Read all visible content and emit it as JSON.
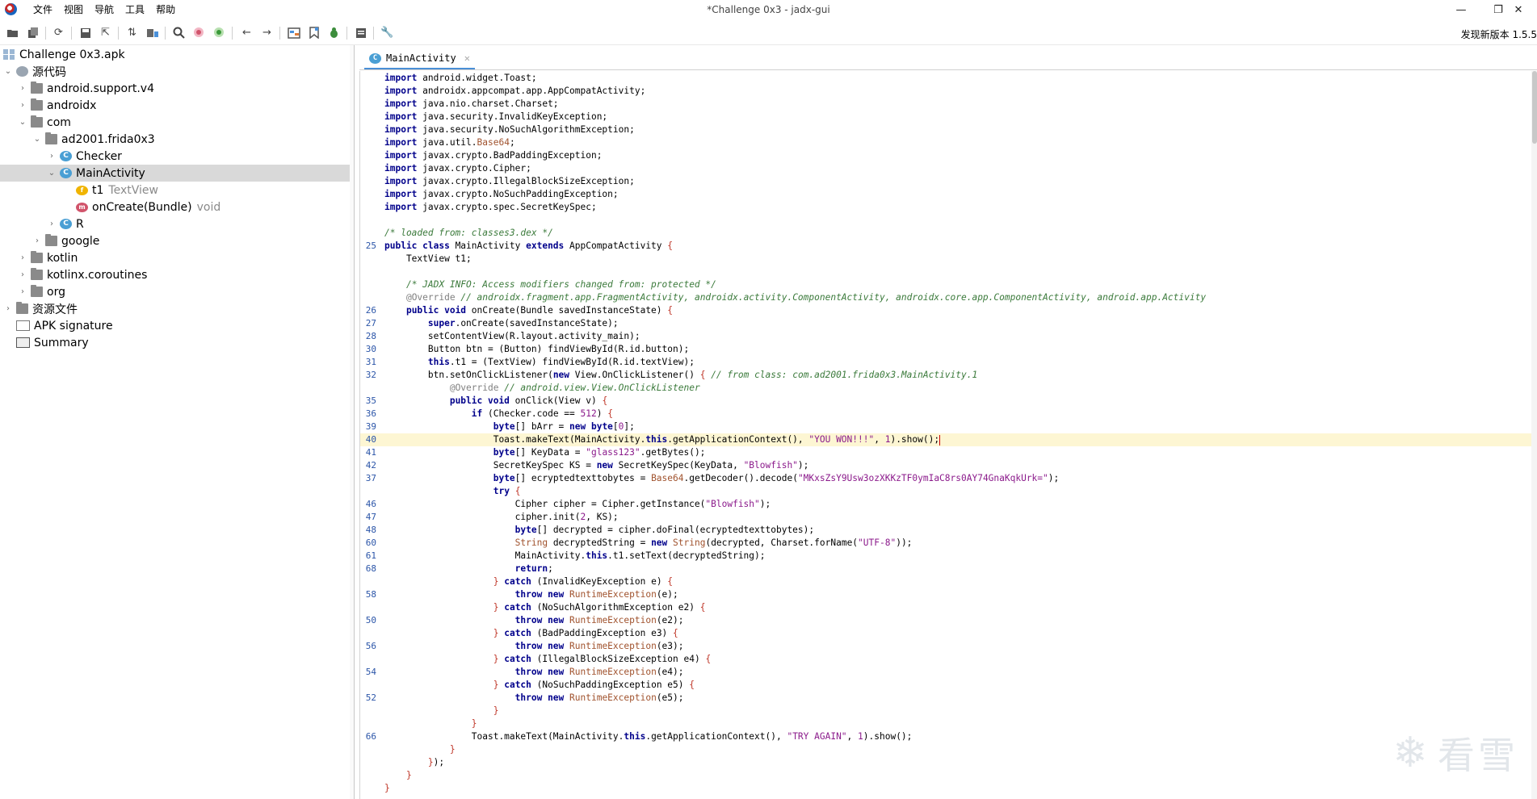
{
  "window": {
    "title": "*Challenge 0x3 - jadx-gui",
    "menu": [
      "文件",
      "视图",
      "导航",
      "工具",
      "帮助"
    ],
    "controls": {
      "minimize": "—",
      "maximize": "❐",
      "close": "✕"
    }
  },
  "toolbar": {
    "update_notice": "发现新版本 1.5.5"
  },
  "tree": {
    "root": "Challenge 0x3.apk",
    "source": "源代码",
    "pkg_support": "android.support.v4",
    "pkg_androidx": "androidx",
    "pkg_com": "com",
    "pkg_ad2001": "ad2001.frida0x3",
    "class_checker": "Checker",
    "class_main": "MainActivity",
    "field_t1": "t1",
    "field_t1_type": "TextView",
    "method_oncreate": "onCreate(Bundle)",
    "method_oncreate_type": "void",
    "class_r": "R",
    "pkg_google": "google",
    "pkg_kotlin": "kotlin",
    "pkg_kotlinx": "kotlinx.coroutines",
    "pkg_org": "org",
    "resources": "资源文件",
    "apk_signature": "APK signature",
    "summary": "Summary"
  },
  "editor": {
    "tab_label": "MainActivity",
    "tab_close": "✕",
    "watermark": "看雪",
    "lines": [
      {
        "ln": "",
        "html": "<span class='kw'>import</span> android.widget.Toast;"
      },
      {
        "ln": "",
        "html": "<span class='kw'>import</span> androidx.appcompat.app.AppCompatActivity;"
      },
      {
        "ln": "",
        "html": "<span class='kw'>import</span> java.nio.charset.Charset;"
      },
      {
        "ln": "",
        "html": "<span class='kw'>import</span> java.security.InvalidKeyException;"
      },
      {
        "ln": "",
        "html": "<span class='kw'>import</span> java.security.NoSuchAlgorithmException;"
      },
      {
        "ln": "",
        "html": "<span class='kw'>import</span> java.util.<span class='ty'>Base64</span>;"
      },
      {
        "ln": "",
        "html": "<span class='kw'>import</span> javax.crypto.BadPaddingException;"
      },
      {
        "ln": "",
        "html": "<span class='kw'>import</span> javax.crypto.Cipher;"
      },
      {
        "ln": "",
        "html": "<span class='kw'>import</span> javax.crypto.IllegalBlockSizeException;"
      },
      {
        "ln": "",
        "html": "<span class='kw'>import</span> javax.crypto.NoSuchPaddingException;"
      },
      {
        "ln": "",
        "html": "<span class='kw'>import</span> javax.crypto.spec.SecretKeySpec;"
      },
      {
        "ln": "",
        "html": ""
      },
      {
        "ln": "",
        "html": "<span class='cmt'>/* loaded from: classes3.dex */</span>"
      },
      {
        "ln": "25",
        "html": "<span class='kw'>public class</span> MainActivity <span class='kw'>extends</span> AppCompatActivity <span class='br'>{</span>"
      },
      {
        "ln": "",
        "html": "    TextView t1;"
      },
      {
        "ln": "",
        "html": ""
      },
      {
        "ln": "",
        "html": "    <span class='cmt'>/* JADX INFO: Access modifiers changed from: protected */</span>"
      },
      {
        "ln": "",
        "html": "    <span class='ann'>@Override</span> <span class='cmt'>// androidx.fragment.app.FragmentActivity, androidx.activity.ComponentActivity, androidx.core.app.ComponentActivity, android.app.Activity</span>"
      },
      {
        "ln": "26",
        "html": "    <span class='kw'>public void</span> onCreate(Bundle savedInstanceState) <span class='br'>{</span>"
      },
      {
        "ln": "27",
        "html": "        <span class='kw'>super</span>.onCreate(savedInstanceState);"
      },
      {
        "ln": "28",
        "html": "        setContentView(R.layout.activity_main);"
      },
      {
        "ln": "30",
        "html": "        Button btn = (Button) findViewById(R.id.button);"
      },
      {
        "ln": "31",
        "html": "        <span class='kw'>this</span>.t1 = (TextView) findViewById(R.id.textView);"
      },
      {
        "ln": "32",
        "html": "        btn.setOnClickListener(<span class='kw'>new</span> View.OnClickListener() <span class='br'>{</span> <span class='cmt'>// from class: com.ad2001.frida0x3.MainActivity.1</span>"
      },
      {
        "ln": "",
        "html": "            <span class='ann'>@Override</span> <span class='cmt'>// android.view.View.OnClickListener</span>"
      },
      {
        "ln": "35",
        "html": "            <span class='kw'>public void</span> onClick(View v) <span class='br'>{</span>"
      },
      {
        "ln": "36",
        "html": "                <span class='kw'>if</span> (Checker.code == <span class='str'>512</span>) <span class='br'>{</span>"
      },
      {
        "ln": "39",
        "html": "                    <span class='kw'>byte</span>[] bArr = <span class='kw'>new byte</span>[<span class='str'>0</span>];"
      },
      {
        "ln": "40",
        "hl": true,
        "html": "                    Toast.makeText(MainActivity.<span class='kw'>this</span>.getApplicationContext(), <span class='str'>\"YOU WON!!!\"</span>, <span class='str'>1</span>).show();<span class='caret-mark'></span>"
      },
      {
        "ln": "41",
        "html": "                    <span class='kw'>byte</span>[] KeyData = <span class='str'>\"glass123\"</span>.getBytes();"
      },
      {
        "ln": "42",
        "html": "                    SecretKeySpec KS = <span class='kw'>new</span> SecretKeySpec(KeyData, <span class='str'>\"Blowfish\"</span>);"
      },
      {
        "ln": "37",
        "html": "                    <span class='kw'>byte</span>[] ecryptedtexttobytes = <span class='ty'>Base64</span>.getDecoder().decode(<span class='str'>\"MKxsZsY9Usw3ozXKKzTF0ymIaC8rs0AY74GnaKqkUrk=\"</span>);"
      },
      {
        "ln": "",
        "html": "                    <span class='kw'>try</span> <span class='br'>{</span>"
      },
      {
        "ln": "46",
        "html": "                        Cipher cipher = Cipher.getInstance(<span class='str'>\"Blowfish\"</span>);"
      },
      {
        "ln": "47",
        "html": "                        cipher.init(<span class='str'>2</span>, KS);"
      },
      {
        "ln": "48",
        "html": "                        <span class='kw'>byte</span>[] decrypted = cipher.doFinal(ecryptedtexttobytes);"
      },
      {
        "ln": "60",
        "html": "                        <span class='ty'>String</span> decryptedString = <span class='kw'>new</span> <span class='ty'>String</span>(decrypted, Charset.forName(<span class='str'>\"UTF-8\"</span>));"
      },
      {
        "ln": "61",
        "html": "                        MainActivity.<span class='kw'>this</span>.t1.setText(decryptedString);"
      },
      {
        "ln": "68",
        "html": "                        <span class='kw'>return</span>;"
      },
      {
        "ln": "",
        "html": "                    <span class='br'>}</span> <span class='kw'>catch</span> (InvalidKeyException e) <span class='br'>{</span>"
      },
      {
        "ln": "58",
        "html": "                        <span class='kw'>throw new</span> <span class='ty'>RuntimeException</span>(e);"
      },
      {
        "ln": "",
        "html": "                    <span class='br'>}</span> <span class='kw'>catch</span> (NoSuchAlgorithmException e2) <span class='br'>{</span>"
      },
      {
        "ln": "50",
        "html": "                        <span class='kw'>throw new</span> <span class='ty'>RuntimeException</span>(e2);"
      },
      {
        "ln": "",
        "html": "                    <span class='br'>}</span> <span class='kw'>catch</span> (BadPaddingException e3) <span class='br'>{</span>"
      },
      {
        "ln": "56",
        "html": "                        <span class='kw'>throw new</span> <span class='ty'>RuntimeException</span>(e3);"
      },
      {
        "ln": "",
        "html": "                    <span class='br'>}</span> <span class='kw'>catch</span> (IllegalBlockSizeException e4) <span class='br'>{</span>"
      },
      {
        "ln": "54",
        "html": "                        <span class='kw'>throw new</span> <span class='ty'>RuntimeException</span>(e4);"
      },
      {
        "ln": "",
        "html": "                    <span class='br'>}</span> <span class='kw'>catch</span> (NoSuchPaddingException e5) <span class='br'>{</span>"
      },
      {
        "ln": "52",
        "html": "                        <span class='kw'>throw new</span> <span class='ty'>RuntimeException</span>(e5);"
      },
      {
        "ln": "",
        "html": "                    <span class='br'>}</span>"
      },
      {
        "ln": "",
        "html": "                <span class='br'>}</span>"
      },
      {
        "ln": "66",
        "html": "                Toast.makeText(MainActivity.<span class='kw'>this</span>.getApplicationContext(), <span class='str'>\"TRY AGAIN\"</span>, <span class='str'>1</span>).show();"
      },
      {
        "ln": "",
        "html": "            <span class='br'>}</span>"
      },
      {
        "ln": "",
        "html": "        <span class='br'>}</span>);"
      },
      {
        "ln": "",
        "html": "    <span class='br'>}</span>"
      },
      {
        "ln": "",
        "html": "<span class='br'>}</span>"
      }
    ]
  }
}
